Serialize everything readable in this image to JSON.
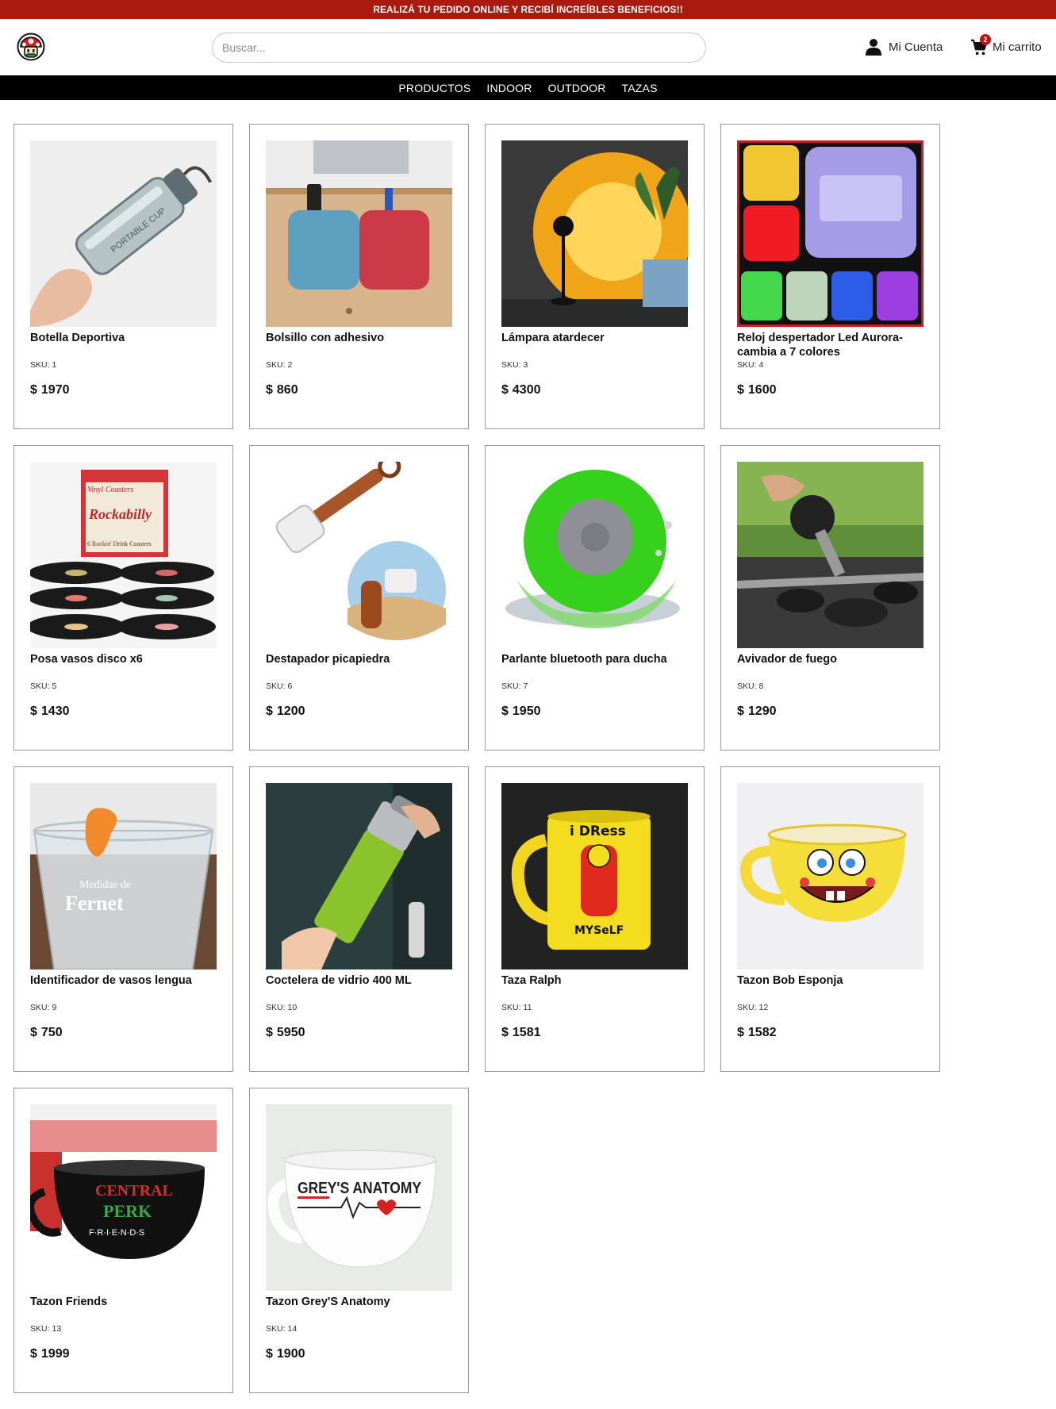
{
  "promo": {
    "text": "REALIZÁ TU PEDIDO ONLINE Y RECIBÍ INCREÍBLES BENEFICIOS!!"
  },
  "header": {
    "search_placeholder": "Buscar...",
    "account_label": "Mi Cuenta",
    "cart_label": "Mi carrito",
    "cart_count": "2"
  },
  "nav": {
    "items": [
      {
        "label": "PRODUCTOS"
      },
      {
        "label": "INDOOR"
      },
      {
        "label": "OUTDOOR"
      },
      {
        "label": "TAZAS"
      }
    ]
  },
  "sku_prefix": "SKU:",
  "currency": "$",
  "products": [
    {
      "name": "Botella Deportiva",
      "sku": "1",
      "price": "1970"
    },
    {
      "name": "Bolsillo con adhesivo",
      "sku": "2",
      "price": "860"
    },
    {
      "name": "Lámpara atardecer",
      "sku": "3",
      "price": "4300"
    },
    {
      "name": "Reloj despertador Led Aurora- cambia a 7 colores",
      "sku": "4",
      "price": "1600"
    },
    {
      "name": "Posa vasos disco x6",
      "sku": "5",
      "price": "1430"
    },
    {
      "name": "Destapador picapiedra",
      "sku": "6",
      "price": "1200"
    },
    {
      "name": "Parlante bluetooth para ducha",
      "sku": "7",
      "price": "1950"
    },
    {
      "name": "Avivador de fuego",
      "sku": "8",
      "price": "1290"
    },
    {
      "name": "Identificador de vasos lengua",
      "sku": "9",
      "price": "750"
    },
    {
      "name": "Coctelera de vidrio 400 ML",
      "sku": "10",
      "price": "5950"
    },
    {
      "name": "Taza Ralph",
      "sku": "11",
      "price": "1581"
    },
    {
      "name": "Tazon Bob Esponja",
      "sku": "12",
      "price": "1582"
    },
    {
      "name": "Tazon Friends",
      "sku": "13",
      "price": "1999"
    },
    {
      "name": "Tazon Grey'S Anatomy",
      "sku": "14",
      "price": "1900"
    }
  ],
  "image_text": {
    "bottle": "PORTABLE CUP",
    "coasters_1": "Vinyl Coasters",
    "coasters_2": "Rockabilly",
    "coasters_3": "6 Rockin' Drink Coasters",
    "fernet_1": "Medidas de",
    "fernet_2": "Fernet",
    "ralph_1": "i DRess",
    "ralph_2": "MYSeLF",
    "friends_1": "CENTRAL",
    "friends_2": "PERK",
    "friends_3": "F·R·I·E·N·D·S",
    "greys": "GREY'S ANATOMY"
  },
  "colors": {
    "brand_red": "#ab1a0f",
    "nav_black": "#000000",
    "badge_red": "#c01010"
  }
}
